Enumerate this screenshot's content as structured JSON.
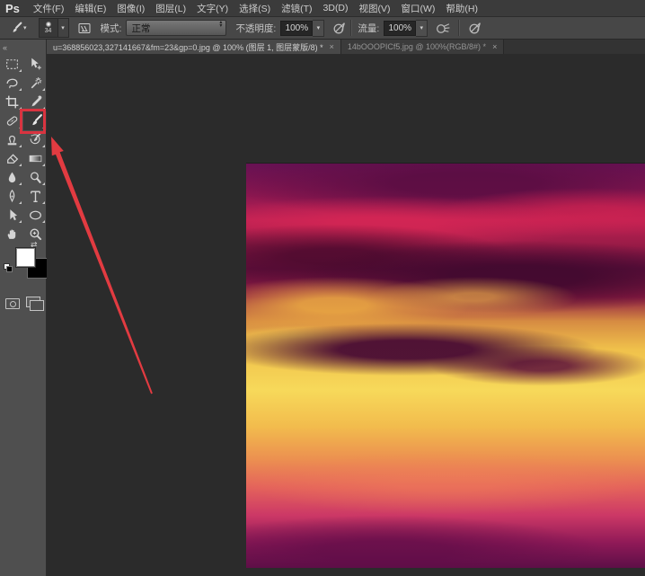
{
  "app": {
    "logo": "Ps"
  },
  "menu": {
    "items": [
      "文件(F)",
      "编辑(E)",
      "图像(I)",
      "图层(L)",
      "文字(Y)",
      "选择(S)",
      "滤镜(T)",
      "3D(D)",
      "视图(V)",
      "窗口(W)",
      "帮助(H)"
    ]
  },
  "options": {
    "brush_size": "34",
    "mode_label": "模式:",
    "mode_value": "正常",
    "opacity_label": "不透明度:",
    "opacity_value": "100%",
    "flow_label": "流量:",
    "flow_value": "100%"
  },
  "tabs": [
    {
      "title": "u=368856023,327141667&fm=23&gp=0.jpg @ 100% (图层 1, 图层蒙版/8) *",
      "close": "×",
      "active": true
    },
    {
      "title": "14bOOOPICf5.jpg @ 100%(RGB/8#) *",
      "close": "×",
      "active": false
    }
  ],
  "toolbar": {
    "collapse_glyph": "«",
    "swap_glyph": "⇄",
    "tools": [
      "rectangular-marquee",
      "move",
      "lasso",
      "magic-wand",
      "crop",
      "eyedropper",
      "spot-healing-brush",
      "brush",
      "clone-stamp",
      "history-brush",
      "eraser",
      "gradient",
      "blur",
      "dodge",
      "pen",
      "horizontal-type",
      "path-selection",
      "ellipse-shape",
      "hand",
      "zoom"
    ],
    "selected_tool": "brush",
    "foreground_color": "#ffffff",
    "background_color": "#000000"
  },
  "icons": {
    "options_bar": [
      "brush-preset-icon",
      "brush-tip-icon",
      "toggle-brush-panel-icon",
      "pressure-opacity-icon",
      "airbrush-icon",
      "pressure-size-icon"
    ],
    "tab_close": "close-icon"
  },
  "annotation": {
    "red": "#d93440",
    "shapes": [
      "highlight-box-around-brush-tool",
      "arrow-pointing-to-brush-tool"
    ]
  },
  "canvas": {
    "content": "sunset-sky-photo",
    "palette": [
      "#661153",
      "#c02254",
      "#f7d95a",
      "#ec9150",
      "#5d0f47"
    ]
  }
}
